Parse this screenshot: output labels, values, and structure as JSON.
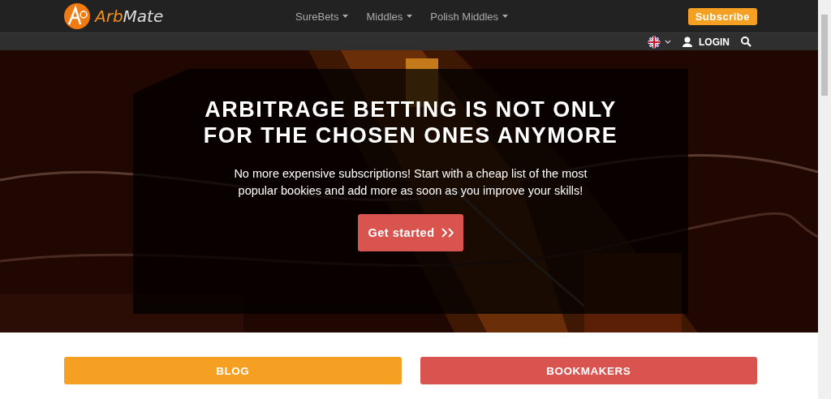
{
  "navbar": {
    "brand": [
      "Arb",
      "Mate"
    ],
    "menu": [
      {
        "label": "SureBets",
        "has_menu": true
      },
      {
        "label": "Middles",
        "has_menu": true
      },
      {
        "label": "Polish Middles",
        "has_menu": true
      }
    ],
    "subscribe": "Subscribe"
  },
  "subbar": {
    "login": "LOGIN"
  },
  "hero": {
    "title": [
      "ARBITRAGE BETTING IS NOT ONLY",
      "FOR THE CHOSEN ONES ANYMORE"
    ],
    "text": "No more expensive subscriptions! Start with a cheap list of the most popular bookies and add more as soon as you improve your skills!",
    "button": "Get started"
  },
  "links": [
    {
      "label": "BLOG",
      "color": "#f6a023"
    },
    {
      "label": "BOOKMAKERS",
      "color": "#d9534f"
    }
  ]
}
